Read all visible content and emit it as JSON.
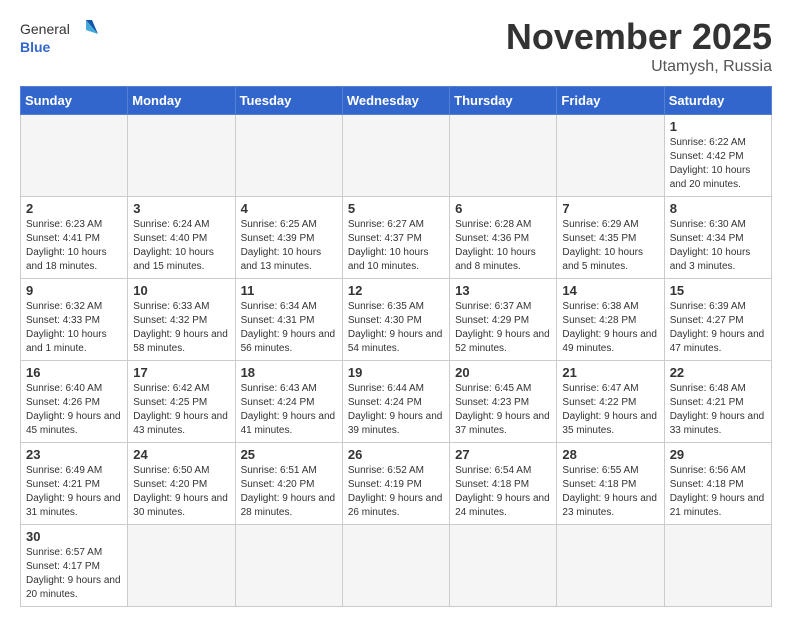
{
  "header": {
    "logo_general": "General",
    "logo_blue": "Blue",
    "month_title": "November 2025",
    "location": "Utamysh, Russia"
  },
  "days_of_week": [
    "Sunday",
    "Monday",
    "Tuesday",
    "Wednesday",
    "Thursday",
    "Friday",
    "Saturday"
  ],
  "weeks": [
    [
      {
        "day": "",
        "info": ""
      },
      {
        "day": "",
        "info": ""
      },
      {
        "day": "",
        "info": ""
      },
      {
        "day": "",
        "info": ""
      },
      {
        "day": "",
        "info": ""
      },
      {
        "day": "",
        "info": ""
      },
      {
        "day": "1",
        "info": "Sunrise: 6:22 AM\nSunset: 4:42 PM\nDaylight: 10 hours\nand 20 minutes."
      }
    ],
    [
      {
        "day": "2",
        "info": "Sunrise: 6:23 AM\nSunset: 4:41 PM\nDaylight: 10 hours\nand 18 minutes."
      },
      {
        "day": "3",
        "info": "Sunrise: 6:24 AM\nSunset: 4:40 PM\nDaylight: 10 hours\nand 15 minutes."
      },
      {
        "day": "4",
        "info": "Sunrise: 6:25 AM\nSunset: 4:39 PM\nDaylight: 10 hours\nand 13 minutes."
      },
      {
        "day": "5",
        "info": "Sunrise: 6:27 AM\nSunset: 4:37 PM\nDaylight: 10 hours\nand 10 minutes."
      },
      {
        "day": "6",
        "info": "Sunrise: 6:28 AM\nSunset: 4:36 PM\nDaylight: 10 hours\nand 8 minutes."
      },
      {
        "day": "7",
        "info": "Sunrise: 6:29 AM\nSunset: 4:35 PM\nDaylight: 10 hours\nand 5 minutes."
      },
      {
        "day": "8",
        "info": "Sunrise: 6:30 AM\nSunset: 4:34 PM\nDaylight: 10 hours\nand 3 minutes."
      }
    ],
    [
      {
        "day": "9",
        "info": "Sunrise: 6:32 AM\nSunset: 4:33 PM\nDaylight: 10 hours\nand 1 minute."
      },
      {
        "day": "10",
        "info": "Sunrise: 6:33 AM\nSunset: 4:32 PM\nDaylight: 9 hours\nand 58 minutes."
      },
      {
        "day": "11",
        "info": "Sunrise: 6:34 AM\nSunset: 4:31 PM\nDaylight: 9 hours\nand 56 minutes."
      },
      {
        "day": "12",
        "info": "Sunrise: 6:35 AM\nSunset: 4:30 PM\nDaylight: 9 hours\nand 54 minutes."
      },
      {
        "day": "13",
        "info": "Sunrise: 6:37 AM\nSunset: 4:29 PM\nDaylight: 9 hours\nand 52 minutes."
      },
      {
        "day": "14",
        "info": "Sunrise: 6:38 AM\nSunset: 4:28 PM\nDaylight: 9 hours\nand 49 minutes."
      },
      {
        "day": "15",
        "info": "Sunrise: 6:39 AM\nSunset: 4:27 PM\nDaylight: 9 hours\nand 47 minutes."
      }
    ],
    [
      {
        "day": "16",
        "info": "Sunrise: 6:40 AM\nSunset: 4:26 PM\nDaylight: 9 hours\nand 45 minutes."
      },
      {
        "day": "17",
        "info": "Sunrise: 6:42 AM\nSunset: 4:25 PM\nDaylight: 9 hours\nand 43 minutes."
      },
      {
        "day": "18",
        "info": "Sunrise: 6:43 AM\nSunset: 4:24 PM\nDaylight: 9 hours\nand 41 minutes."
      },
      {
        "day": "19",
        "info": "Sunrise: 6:44 AM\nSunset: 4:24 PM\nDaylight: 9 hours\nand 39 minutes."
      },
      {
        "day": "20",
        "info": "Sunrise: 6:45 AM\nSunset: 4:23 PM\nDaylight: 9 hours\nand 37 minutes."
      },
      {
        "day": "21",
        "info": "Sunrise: 6:47 AM\nSunset: 4:22 PM\nDaylight: 9 hours\nand 35 minutes."
      },
      {
        "day": "22",
        "info": "Sunrise: 6:48 AM\nSunset: 4:21 PM\nDaylight: 9 hours\nand 33 minutes."
      }
    ],
    [
      {
        "day": "23",
        "info": "Sunrise: 6:49 AM\nSunset: 4:21 PM\nDaylight: 9 hours\nand 31 minutes."
      },
      {
        "day": "24",
        "info": "Sunrise: 6:50 AM\nSunset: 4:20 PM\nDaylight: 9 hours\nand 30 minutes."
      },
      {
        "day": "25",
        "info": "Sunrise: 6:51 AM\nSunset: 4:20 PM\nDaylight: 9 hours\nand 28 minutes."
      },
      {
        "day": "26",
        "info": "Sunrise: 6:52 AM\nSunset: 4:19 PM\nDaylight: 9 hours\nand 26 minutes."
      },
      {
        "day": "27",
        "info": "Sunrise: 6:54 AM\nSunset: 4:18 PM\nDaylight: 9 hours\nand 24 minutes."
      },
      {
        "day": "28",
        "info": "Sunrise: 6:55 AM\nSunset: 4:18 PM\nDaylight: 9 hours\nand 23 minutes."
      },
      {
        "day": "29",
        "info": "Sunrise: 6:56 AM\nSunset: 4:18 PM\nDaylight: 9 hours\nand 21 minutes."
      }
    ],
    [
      {
        "day": "30",
        "info": "Sunrise: 6:57 AM\nSunset: 4:17 PM\nDaylight: 9 hours\nand 20 minutes."
      },
      {
        "day": "",
        "info": ""
      },
      {
        "day": "",
        "info": ""
      },
      {
        "day": "",
        "info": ""
      },
      {
        "day": "",
        "info": ""
      },
      {
        "day": "",
        "info": ""
      },
      {
        "day": "",
        "info": ""
      }
    ]
  ]
}
